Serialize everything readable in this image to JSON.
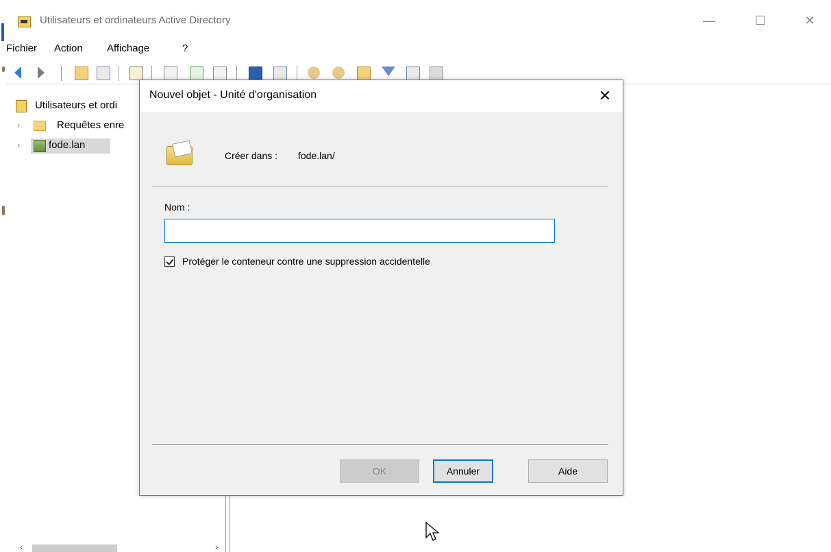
{
  "window": {
    "title": "Utilisateurs et ordinateurs Active Directory",
    "minimize": "—",
    "maximize": "☐",
    "close": "✕"
  },
  "menubar": {
    "items": [
      "Fichier",
      "Action",
      "Affichage",
      "?"
    ]
  },
  "tree": {
    "root_label": "Utilisateurs et ordi",
    "items": [
      {
        "label": "Requêtes enre",
        "icon": "folder-icon"
      },
      {
        "label": "fode.lan",
        "icon": "domain-icon",
        "selected": true
      }
    ],
    "chevron": "›"
  },
  "scrollbar": {
    "left_arrow": "‹",
    "right_arrow": "›"
  },
  "dialog": {
    "title": "Nouvel objet - Unité d'organisation",
    "close": "✕",
    "create_in_label": "Créer dans :",
    "create_in_value": "fode.lan/",
    "name_label": "Nom :",
    "name_value": "",
    "protect_checkbox_label": "Protéger le conteneur contre une suppression accidentelle",
    "protect_checked": true,
    "ok_label": "OK",
    "cancel_label": "Annuler",
    "help_label": "Aide"
  },
  "colors": {
    "accent": "#0078d7",
    "dialog_bg": "#f0f0f0",
    "selection": "#d9d9d9"
  }
}
